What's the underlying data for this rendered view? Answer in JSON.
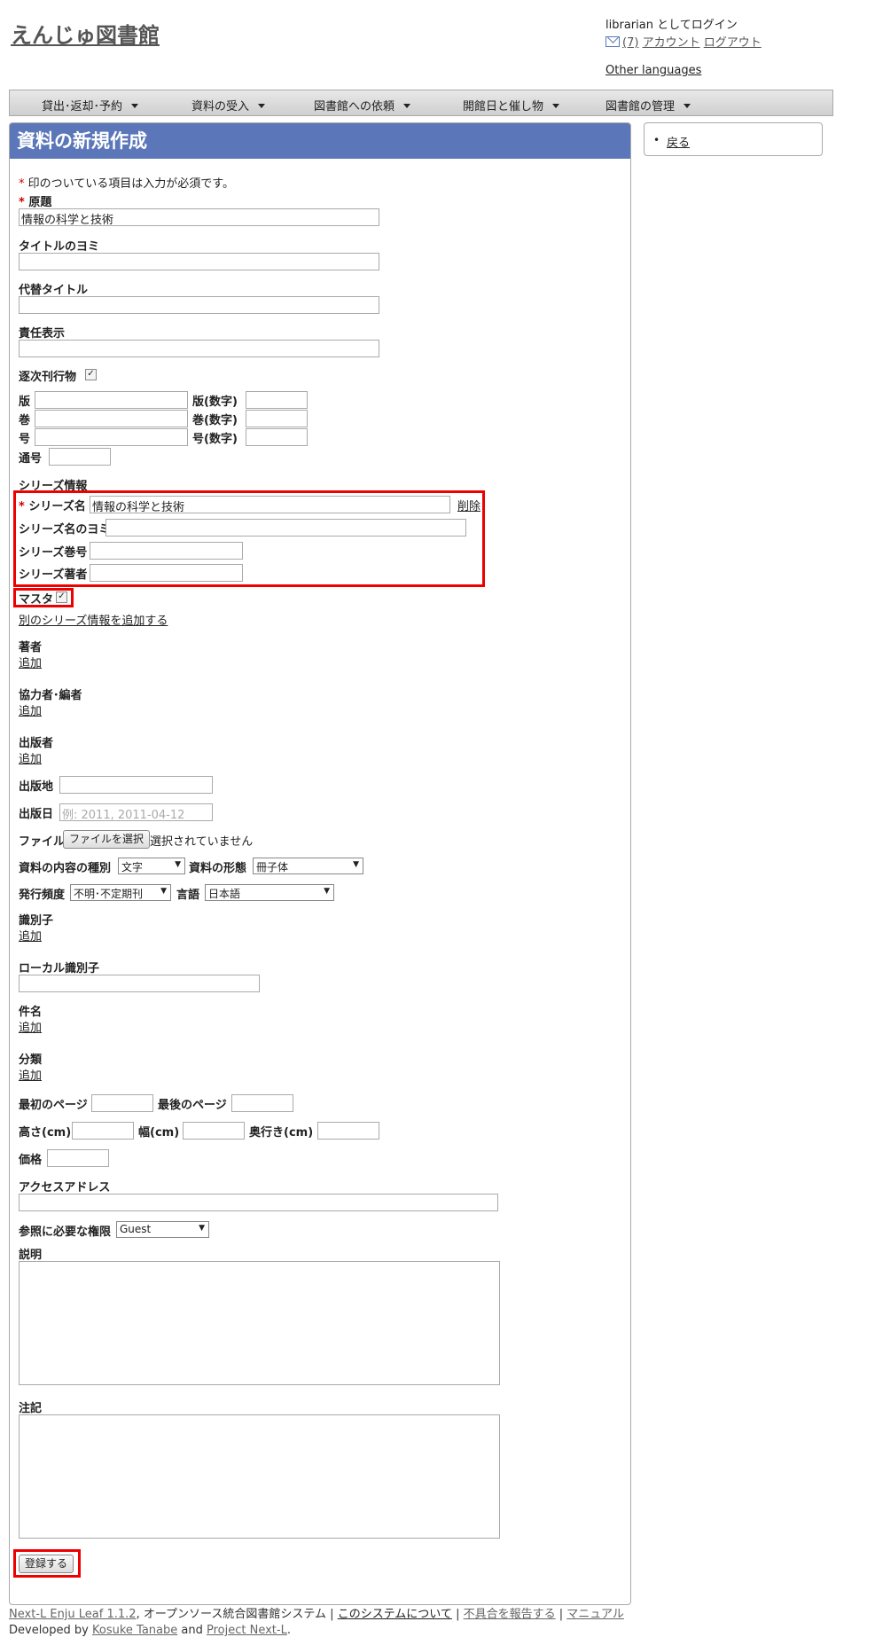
{
  "header": {
    "site_title": "えんじゅ図書館",
    "login_text": "librarian としてログイン",
    "message_count": "(7)",
    "account_link": "アカウント",
    "logout_link": "ログアウト",
    "other_languages": "Other languages"
  },
  "nav": {
    "items": [
      "貸出･返却･予約",
      "資料の受入",
      "図書館への依頼",
      "開館日と催し物",
      "図書館の管理"
    ]
  },
  "sidebar": {
    "back_link": "戻る"
  },
  "form": {
    "heading": "資料の新規作成",
    "required_note": "印のついている項目は入力が必須です。",
    "original_title_label": "原題",
    "original_title_value": "情報の科学と技術",
    "title_transcription_label": "タイトルのヨミ",
    "title_alternative_label": "代替タイトル",
    "statement_of_responsibility_label": "責任表示",
    "serial_label": "逐次刊行物",
    "edition_label": "版",
    "edition_number_label": "版(数字)",
    "volume_label": "巻",
    "volume_number_label": "巻(数字)",
    "issue_label": "号",
    "issue_number_label": "号(数字)",
    "serial_number_label": "通号",
    "series": {
      "section_label": "シリーズ情報",
      "name_label": "シリーズ名",
      "name_value": "情報の科学と技術",
      "delete_link": "削除",
      "transcription_label": "シリーズ名のヨミ",
      "volume_label": "シリーズ巻号",
      "creator_label": "シリーズ著者",
      "master_label": "マスタ",
      "add_link": "別のシリーズ情報を追加する"
    },
    "add_label": "追加",
    "creator_label": "著者",
    "contributor_label": "協力者･編者",
    "publisher_label": "出版者",
    "place_label": "出版地",
    "date_label": "出版日",
    "date_placeholder": "例: 2011, 2011-04-12",
    "file_label": "ファイル",
    "file_button": "ファイルを選択",
    "file_status": "選択されていません",
    "content_type_label": "資料の内容の種別",
    "content_type_value": "文字",
    "carrier_type_label": "資料の形態",
    "carrier_type_value": "冊子体",
    "frequency_label": "発行頻度",
    "frequency_value": "不明･不定期刊",
    "language_label": "言語",
    "language_value": "日本語",
    "identifier_label": "識別子",
    "local_identifier_label": "ローカル識別子",
    "subject_label": "件名",
    "classification_label": "分類",
    "start_page_label": "最初のページ",
    "end_page_label": "最後のページ",
    "height_label": "高さ(cm)",
    "width_label": "幅(cm)",
    "depth_label": "奥行き(cm)",
    "price_label": "価格",
    "access_address_label": "アクセスアドレス",
    "required_role_label": "参照に必要な権限",
    "required_role_value": "Guest",
    "description_label": "説明",
    "note_label": "注記",
    "submit_label": "登録する"
  },
  "footer": {
    "product_link": "Next-L Enju Leaf 1.1.2",
    "product_desc": ", オープンソース統合図書館システム",
    "separator": "|",
    "about_link": "このシステムについて",
    "report_link": "不具合を報告する",
    "manual_link": "マニュアル",
    "developed_by": "Developed by",
    "author_link": "Kosuke Tanabe",
    "and_text": "and",
    "project_link": "Project Next-L",
    "period": "."
  }
}
